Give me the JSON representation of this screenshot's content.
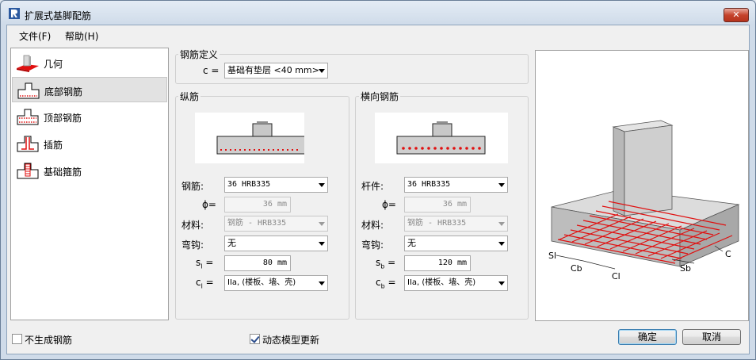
{
  "window": {
    "title": "扩展式基脚配筋",
    "close_label": "✕"
  },
  "menu": [
    "文件(F)",
    "帮助(H)"
  ],
  "sidebar": {
    "items": [
      {
        "label": "几何",
        "icon": "geometry-icon"
      },
      {
        "label": "底部钢筋",
        "icon": "bottom-rebar-icon",
        "selected": true
      },
      {
        "label": "顶部钢筋",
        "icon": "top-rebar-icon"
      },
      {
        "label": "插筋",
        "icon": "dowel-icon"
      },
      {
        "label": "基础箍筋",
        "icon": "stirrup-icon"
      }
    ]
  },
  "definition": {
    "title": "钢筋定义",
    "c_label": "c =",
    "c_value": "基础有垫层 <40 mm>"
  },
  "longitudinal": {
    "title": "纵筋",
    "bar_label": "钢筋:",
    "bar_value": "36 HRB335",
    "phi_label": "ϕ=",
    "phi_value": "36 mm",
    "material_label": "材料:",
    "material_value": "钢筋 - HRB335",
    "hook_label": "弯钩:",
    "hook_value": "无",
    "s_label": "s",
    "s_sub": "l",
    "s_eq": "=",
    "s_value": "80 mm",
    "c_label": "c",
    "c_sub": "l",
    "c_eq": "=",
    "c_value": "IIa, (楼板、墙、壳)"
  },
  "transverse": {
    "title": "横向钢筋",
    "bar_label": "杆件:",
    "bar_value": "36 HRB335",
    "phi_label": "ϕ=",
    "phi_value": "36 mm",
    "material_label": "材料:",
    "material_value": "钢筋 - HRB335",
    "hook_label": "弯钩:",
    "hook_value": "无",
    "s_label": "s",
    "s_sub": "b",
    "s_eq": "=",
    "s_value": "120 mm",
    "c_label": "c",
    "c_sub": "b",
    "c_eq": "=",
    "c_value": "IIa, (楼板、墙、壳)"
  },
  "preview_labels": {
    "sl": "Sl",
    "cb": "Cb",
    "cl": "Cl",
    "sb": "Sb",
    "c": "C"
  },
  "footer": {
    "no_rebar_label": "不生成钢筋",
    "no_rebar_checked": false,
    "dynamic_update_label": "动态模型更新",
    "dynamic_update_checked": true,
    "ok_label": "确定",
    "cancel_label": "取消"
  },
  "colors": {
    "rebar_red": "#e01010",
    "concrete": "#c9c9c9"
  }
}
